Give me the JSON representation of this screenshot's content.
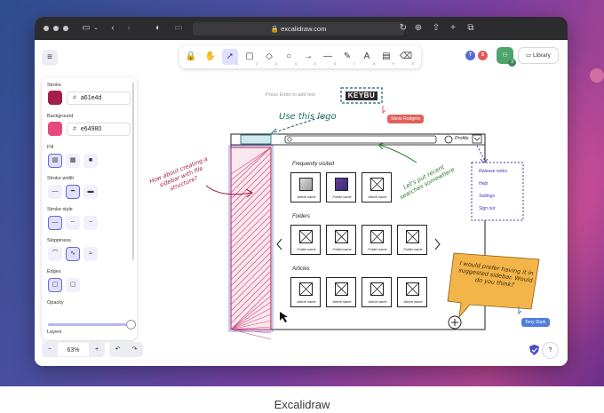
{
  "caption": "Excalidraw",
  "browser": {
    "url": "excalidraw.com"
  },
  "toolbar": {
    "tools": [
      {
        "name": "lock",
        "glyph": "🔒",
        "sub": ""
      },
      {
        "name": "hand",
        "glyph": "✋",
        "sub": ""
      },
      {
        "name": "selection",
        "glyph": "➚",
        "sub": "1"
      },
      {
        "name": "rectangle",
        "glyph": "▢",
        "sub": "2"
      },
      {
        "name": "diamond",
        "glyph": "◇",
        "sub": "3"
      },
      {
        "name": "ellipse",
        "glyph": "○",
        "sub": "4"
      },
      {
        "name": "arrow",
        "glyph": "→",
        "sub": "5"
      },
      {
        "name": "line",
        "glyph": "—",
        "sub": "6"
      },
      {
        "name": "draw",
        "glyph": "✎",
        "sub": "7"
      },
      {
        "name": "text",
        "glyph": "A",
        "sub": "8"
      },
      {
        "name": "image",
        "glyph": "▤",
        "sub": "9"
      },
      {
        "name": "eraser",
        "glyph": "⌫",
        "sub": "0"
      }
    ],
    "hint": "Press Enter to add text"
  },
  "collaborators": {
    "avatars": [
      {
        "initial": "T",
        "color": "#5a6ad6"
      },
      {
        "initial": "S",
        "color": "#e05a5a"
      }
    ],
    "count": "3",
    "library_label": "Library"
  },
  "properties": {
    "stroke_label": "Stroke",
    "stroke_color": "#a61e4d",
    "stroke_hex": "a61e4d",
    "background_label": "Background",
    "background_color": "#e64980",
    "background_hex": "e64980",
    "fill_label": "Fill",
    "stroke_width_label": "Stroke width",
    "stroke_style_label": "Stroke style",
    "sloppiness_label": "Sloppiness",
    "edges_label": "Edges",
    "opacity_label": "Opacity",
    "opacity_value": 100,
    "layers_label": "Layers"
  },
  "bottom": {
    "zoom_out": "−",
    "zoom": "63%",
    "zoom_in": "+",
    "undo": "↶",
    "redo": "↷",
    "help": "?"
  },
  "drawing": {
    "logo_text": "KEYBU",
    "logo_note": "Use this logo",
    "sidebar_note": "How about creating a sidebar with file structure?",
    "search_note": "Let's put recent searches somewhere",
    "profile_label": "Profile",
    "sections": {
      "recent": "Frequently visited",
      "folders": "Folders",
      "articles": "Articles"
    },
    "recent_items": [
      "Article name",
      "Folder name",
      "Article name"
    ],
    "folder_items": [
      "Folder name",
      "Folder name",
      "Folder name",
      "Folder name"
    ],
    "article_items": [
      "Article name",
      "Article name",
      "Article name",
      "Article name"
    ],
    "menu_items": [
      "Release notes",
      "Help",
      "Settings",
      "Sign out"
    ],
    "sticky_note": "I would prefer having it in suggested sidebar. Would do you think?",
    "cursors": [
      {
        "name": "Steve Rodgers",
        "color": "#e0615c"
      },
      {
        "name": "Tony Stark",
        "color": "#4f7de0"
      }
    ]
  }
}
